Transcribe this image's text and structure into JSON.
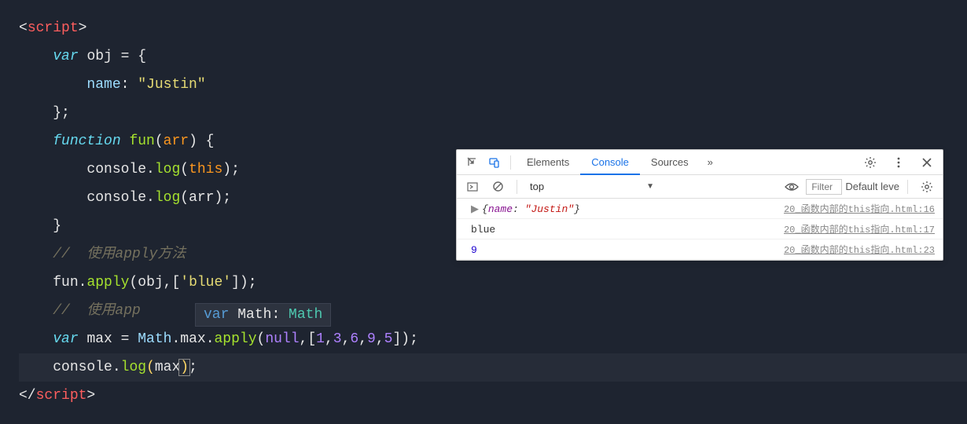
{
  "code": {
    "l1": {
      "open": "<",
      "tag": "script",
      "close": ">"
    },
    "l2": {
      "kw": "var",
      "name": "obj",
      "eq": " = {"
    },
    "l3": {
      "key": "name",
      "colon": ": ",
      "str": "\"Justin\""
    },
    "l4": {
      "close": "};"
    },
    "l5": {
      "kw": "function",
      "fn": "fun",
      "params": "arr",
      "open": ") {"
    },
    "l6": {
      "obj": "console",
      "dot": ".",
      "method": "log",
      "arg": "this",
      "close": ");"
    },
    "l7": {
      "obj": "console",
      "dot": ".",
      "method": "log",
      "arg": "arr",
      "close": ");"
    },
    "l8": {
      "close": "}"
    },
    "l9": {
      "comment": "//  使用apply方法"
    },
    "l10": {
      "obj": "fun",
      "dot": ".",
      "method": "apply",
      "args_obj": "obj",
      "args_arr": "'blue'"
    },
    "l11": {
      "comment": "//  使用app"
    },
    "l12": {
      "kw": "var",
      "name": "max",
      "eq": " = ",
      "obj": "Math",
      "dot1": ".",
      "prop": "max",
      "dot2": ".",
      "method": "apply",
      "null": "null",
      "nums": [
        "1",
        "3",
        "6",
        "9",
        "5"
      ]
    },
    "l13": {
      "obj": "console",
      "dot": ".",
      "method": "log",
      "arg": "max",
      "close": ");"
    },
    "l14": {
      "open": "</",
      "tag": "script",
      "close": ">"
    }
  },
  "tooltip": {
    "kw": "var",
    "name": "Math",
    "colon": ": ",
    "type": "Math"
  },
  "devtools": {
    "tabs": {
      "elements": "Elements",
      "console": "Console",
      "sources": "Sources"
    },
    "toolbar": {
      "context": "top",
      "filter_placeholder": "Filter",
      "level": "Default leve"
    },
    "logs": [
      {
        "type": "object",
        "key": "name",
        "value": "\"Justin\"",
        "src": "20_函数内部的this指向.html:16"
      },
      {
        "type": "text",
        "msg": "blue",
        "src": "20_函数内部的this指向.html:17"
      },
      {
        "type": "number",
        "msg": "9",
        "src": "20_函数内部的this指向.html:23"
      }
    ]
  }
}
